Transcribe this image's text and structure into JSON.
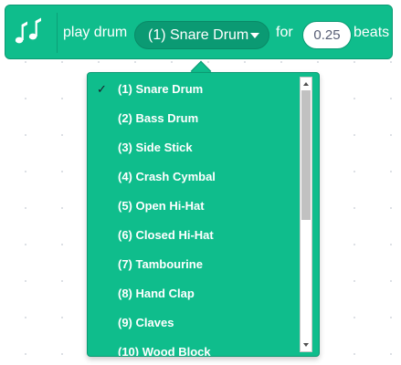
{
  "block": {
    "play_label": "play drum",
    "drum_selected": "(1) Snare Drum",
    "for_label": "for",
    "beats_value": "0.25",
    "beats_label": "beats",
    "color": "#0fbd8c",
    "icon": "music-notes-icon"
  },
  "menu": {
    "check_mark": "✓",
    "items": [
      {
        "label": "(1) Snare Drum",
        "selected": true
      },
      {
        "label": "(2) Bass Drum"
      },
      {
        "label": "(3) Side Stick"
      },
      {
        "label": "(4) Crash Cymbal"
      },
      {
        "label": "(5) Open Hi-Hat"
      },
      {
        "label": "(6) Closed Hi-Hat"
      },
      {
        "label": "(7) Tambourine"
      },
      {
        "label": "(8) Hand Clap"
      },
      {
        "label": "(9) Claves"
      },
      {
        "label": "(10) Wood Block"
      }
    ]
  }
}
